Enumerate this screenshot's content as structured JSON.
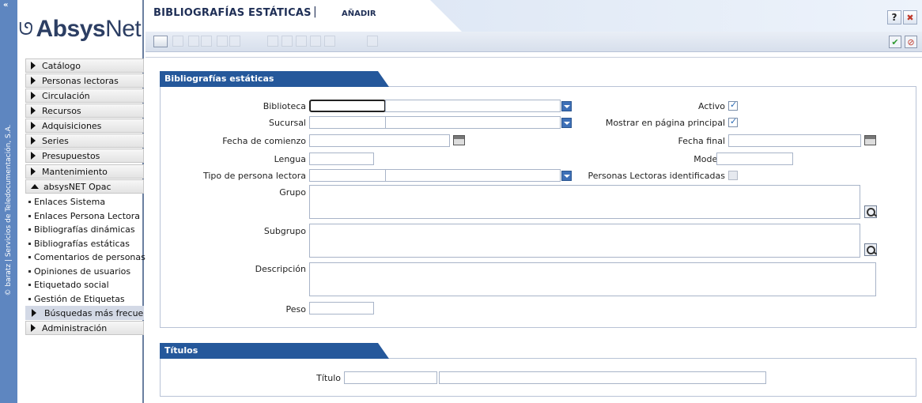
{
  "strip": {
    "collapse_label": "«",
    "vertical_text": "© baratz | Servicios de Teledocumentación, S.A."
  },
  "logo": {
    "swirl": "ᘎ",
    "bold": "Absys",
    "light": "Net"
  },
  "sidebar": {
    "items": [
      {
        "label": "Catálogo"
      },
      {
        "label": "Personas lectoras"
      },
      {
        "label": "Circulación"
      },
      {
        "label": "Recursos"
      },
      {
        "label": "Adquisiciones"
      },
      {
        "label": "Series"
      },
      {
        "label": "Presupuestos"
      },
      {
        "label": "Mantenimiento"
      },
      {
        "label": "absysNET Opac"
      }
    ],
    "subitems": [
      {
        "label": "Enlaces Sistema"
      },
      {
        "label": "Enlaces Persona Lectora"
      },
      {
        "label": "Bibliografías dinámicas"
      },
      {
        "label": "Bibliografías estáticas"
      },
      {
        "label": "Comentarios de personas"
      },
      {
        "label": "Opiniones de usuarios"
      },
      {
        "label": "Etiquetado social"
      },
      {
        "label": "Gestión de Etiquetas"
      }
    ],
    "active_sub": "Búsquedas más frecuentes",
    "admin": "Administración"
  },
  "header": {
    "title": "BIBLIOGRAFÍAS ESTÁTICAS",
    "separator": "|",
    "action": "AÑADIR",
    "help": "?",
    "close": "✖"
  },
  "toolbar": {
    "ok": "✔",
    "cancel": "⊘"
  },
  "form": {
    "panel_title": "Bibliografías estáticas",
    "biblioteca": "Biblioteca",
    "sucursal": "Sucursal",
    "fecha_comienzo": "Fecha de comienzo",
    "lengua": "Lengua",
    "tipo_persona": "Tipo de persona lectora",
    "grupo": "Grupo",
    "subgrupo": "Subgrupo",
    "descripcion": "Descripción",
    "peso": "Peso",
    "activo": "Activo",
    "mostrar": "Mostrar en página principal",
    "fecha_final": "Fecha final",
    "modelo": "Modelo",
    "identificadas": "Personas Lectoras identificadas"
  },
  "titulos": {
    "panel_title": "Títulos",
    "titulo": "Título"
  },
  "colors": {
    "accent": "#25589b",
    "strip": "#5e86c0"
  }
}
